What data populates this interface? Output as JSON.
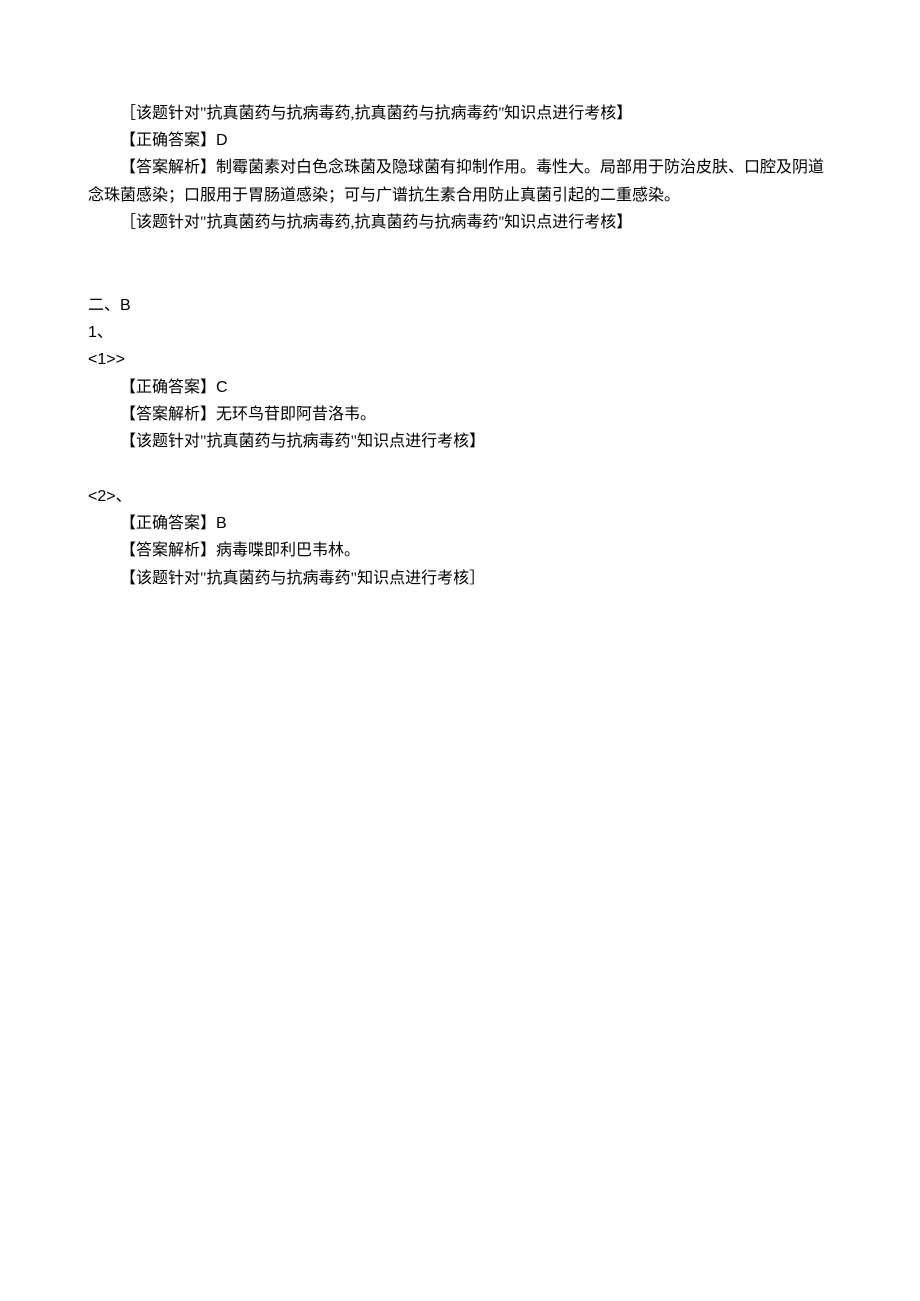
{
  "lines": {
    "l1": "［该题针对\"抗真菌药与抗病毒药,抗真菌药与抗病毒药''知识点进行考核】",
    "l2_pre": "【正确答案】",
    "l2_ans": "D",
    "l3": "【答案解析】制霉菌素对白色念珠菌及隐球菌有抑制作用。毒性大。局部用于防治皮肤、口腔及阴道念珠菌感染；口服用于胃肠道感染；可与广谱抗生素合用防止真菌引起的二重感染。",
    "l4": "［该题针对\"抗真菌药与抗病毒药,抗真菌药与抗病毒药''知识点进行考核】",
    "sec2_pre": "二、",
    "sec2_lat": "B",
    "q1_pre": "1",
    "q1_suf": "、",
    "q1_sub_pre": "<1>>",
    "q1_ans_pre": "【正确答案】",
    "q1_ans": "C",
    "q1_exp": "【答案解析】无环鸟苷即阿昔洛韦。",
    "q1_note": "【该题针对\"抗真菌药与抗病毒药\"知识点进行考核】",
    "q2_sub_pre": "<2>",
    "q2_sub_suf": "、",
    "q2_ans_pre": "【正确答案】",
    "q2_ans": "B",
    "q2_exp": "【答案解析】病毒喋即利巴韦林。",
    "q2_note": "【该题针对\"抗真菌药与抗病毒药\"知识点进行考核］"
  }
}
